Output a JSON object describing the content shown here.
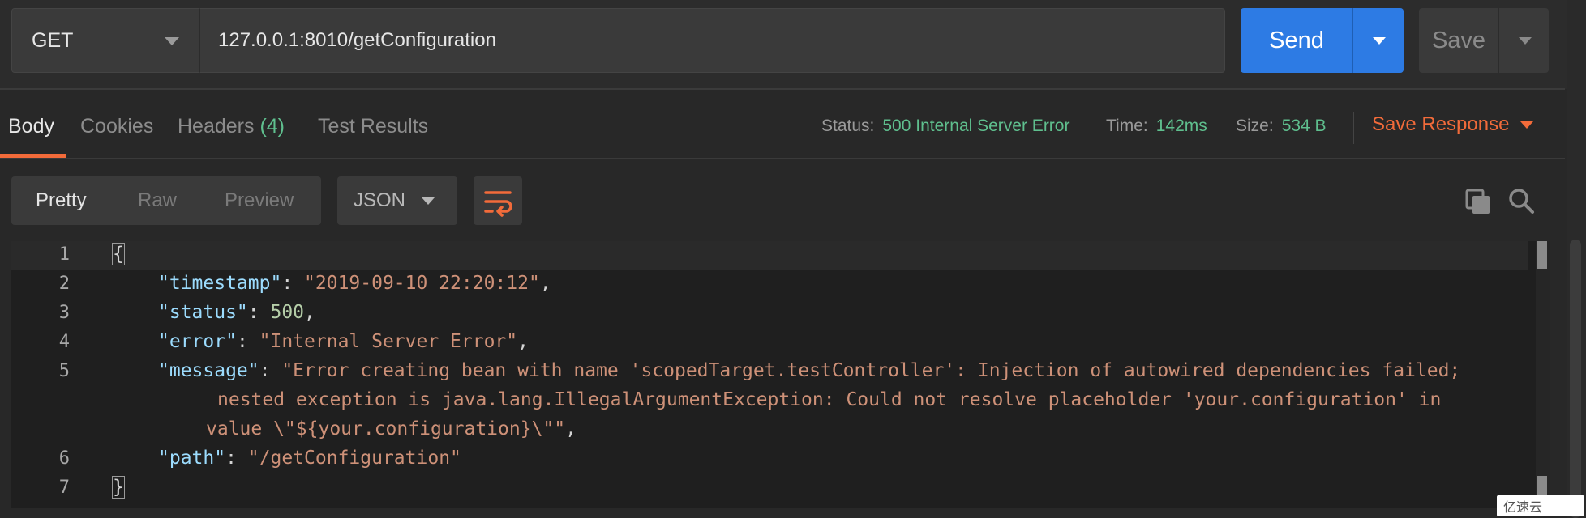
{
  "request": {
    "method": "GET",
    "url": "127.0.0.1:8010/getConfiguration",
    "send_label": "Send",
    "save_label": "Save"
  },
  "response_tabs": {
    "body": "Body",
    "cookies": "Cookies",
    "headers": "Headers",
    "headers_count": "(4)",
    "test_results": "Test Results"
  },
  "response_meta": {
    "status_label": "Status:",
    "status_value": "500 Internal Server Error",
    "time_label": "Time:",
    "time_value": "142ms",
    "size_label": "Size:",
    "size_value": "534 B",
    "save_response": "Save Response"
  },
  "viewer": {
    "modes": [
      "Pretty",
      "Raw",
      "Preview"
    ],
    "active_mode": "Pretty",
    "language": "JSON"
  },
  "code": {
    "line_numbers": [
      "1",
      "2",
      "3",
      "4",
      "5",
      "6",
      "7"
    ],
    "open_brace": "{",
    "close_brace": "}",
    "timestamp_key": "\"timestamp\"",
    "timestamp_val": "\"2019-09-10 22:20:12\"",
    "status_key": "\"status\"",
    "status_val": "500",
    "error_key": "\"error\"",
    "error_val": "\"Internal Server Error\"",
    "message_key": "\"message\"",
    "message_val_1": "\"Error creating bean with name 'scopedTarget.testController': Injection of autowired dependencies failed;",
    "message_val_2": "nested exception is java.lang.IllegalArgumentException: Could not resolve placeholder 'your.configuration' in",
    "message_val_3": "value \\\"${your.configuration}\\\"\"",
    "path_key": "\"path\"",
    "path_val": "\"/getConfiguration\""
  },
  "watermark": "亿速云",
  "colors": {
    "send": "#2d7be4",
    "accent": "#f26b3a",
    "status_ok_text": "#5fbf8e"
  }
}
